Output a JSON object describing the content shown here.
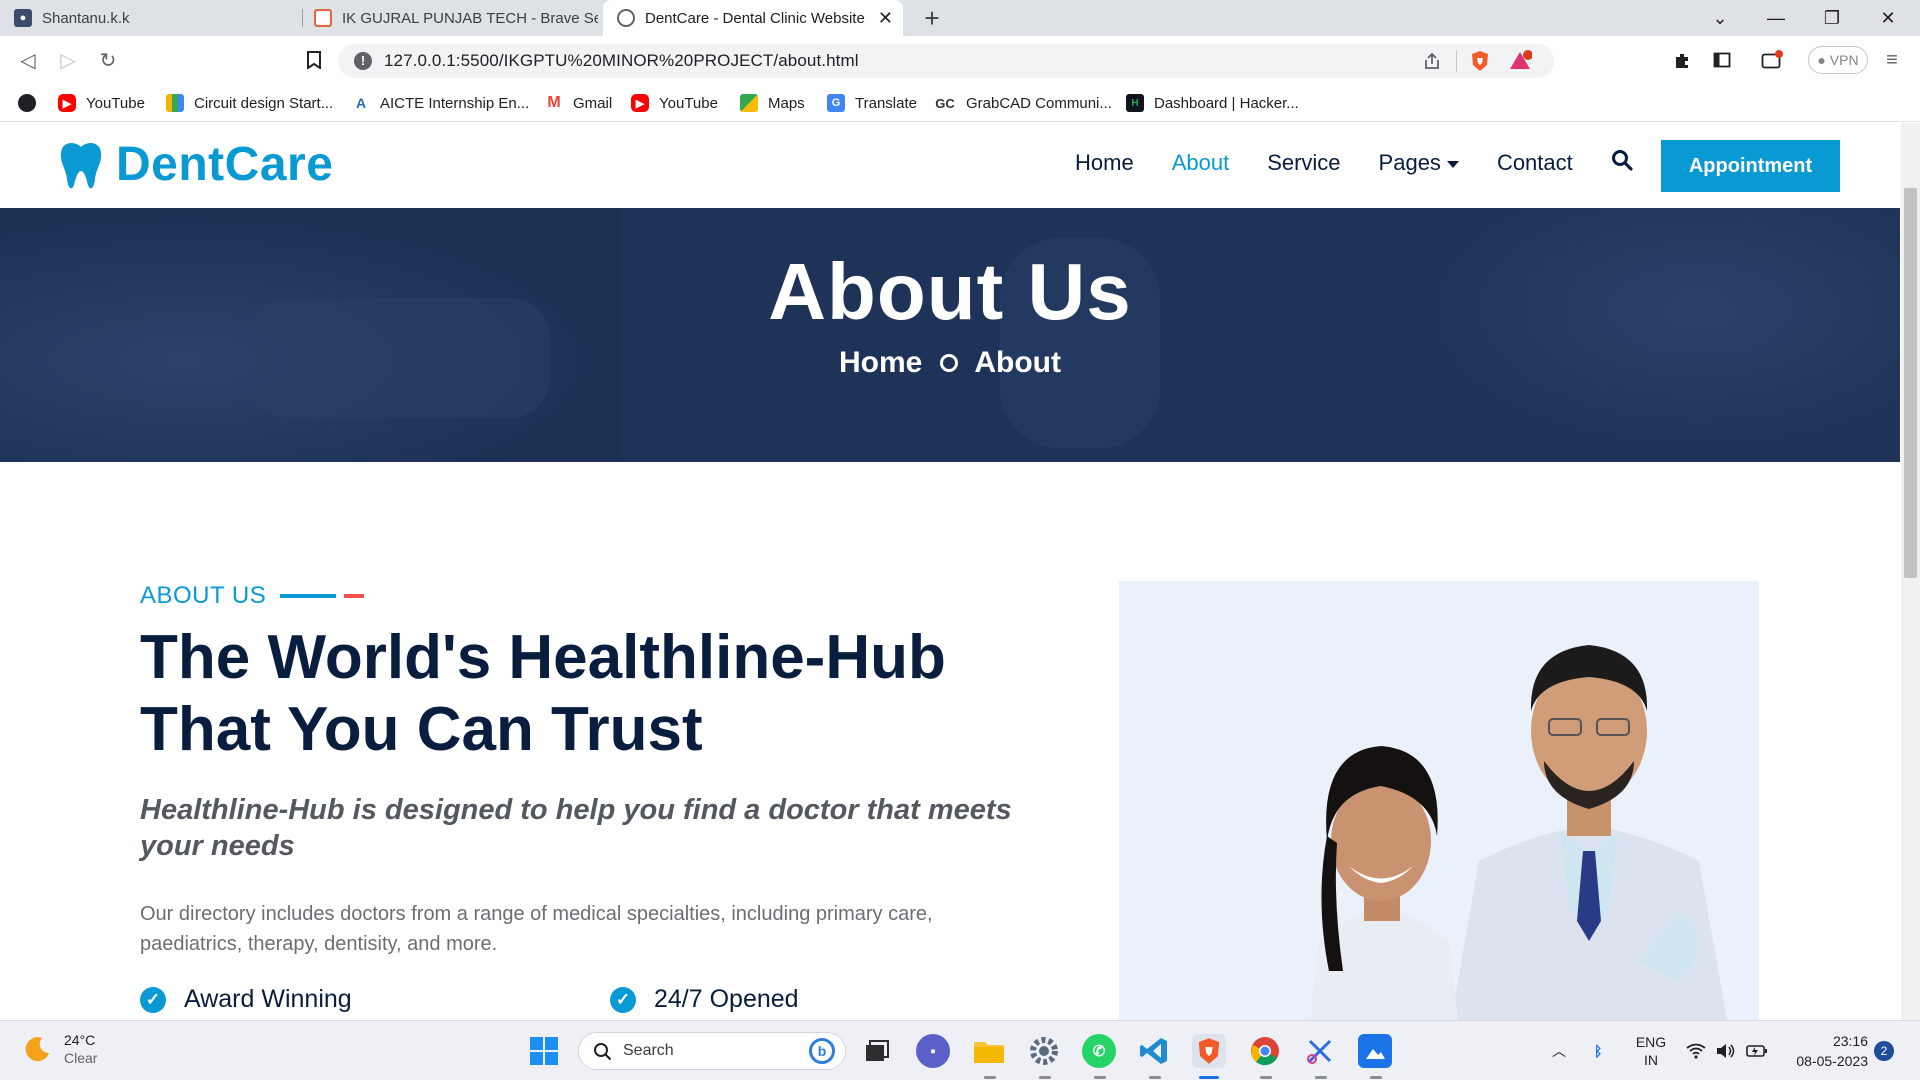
{
  "browser": {
    "tabs": [
      {
        "title": "Shantanu.k.k",
        "active": false
      },
      {
        "title": "IK GUJRAL PUNJAB TECH - Brave Search",
        "active": false
      },
      {
        "title": "DentCare - Dental Clinic Website",
        "active": true
      }
    ],
    "new_tab_icon": "plus-icon",
    "url": "127.0.0.1:5500/IKGPTU%20MINOR%20PROJECT/about.html",
    "vpn_label": "VPN"
  },
  "bookmarks": [
    {
      "label": "YouTube",
      "icon": "youtube-icon",
      "color": "#ff0000"
    },
    {
      "label": "Circuit design Start...",
      "icon": "grid-icon",
      "color": "#f4b400"
    },
    {
      "label": "AICTE Internship En...",
      "icon": "aicte-icon",
      "color": "#2b6cb0"
    },
    {
      "label": "Gmail",
      "icon": "gmail-icon",
      "color": "#ea4335"
    },
    {
      "label": "YouTube",
      "icon": "youtube-icon",
      "color": "#ff0000"
    },
    {
      "label": "Maps",
      "icon": "maps-icon",
      "color": "#34a853"
    },
    {
      "label": "Translate",
      "icon": "translate-icon",
      "color": "#4285f4"
    },
    {
      "label": "GrabCAD Communi...",
      "icon": "grabcad-icon",
      "color": "#333333"
    },
    {
      "label": "Dashboard | Hacker...",
      "icon": "hackerrank-icon",
      "color": "#1ba94c"
    }
  ],
  "site": {
    "logo": "DentCare",
    "nav": {
      "home": "Home",
      "about": "About",
      "service": "Service",
      "pages": "Pages",
      "contact": "Contact",
      "appointment": "Appointment"
    },
    "hero": {
      "title": "About Us",
      "crumb_home": "Home",
      "crumb_current": "About"
    },
    "about": {
      "eyebrow": "ABOUT US",
      "heading": "The World's Healthline-Hub That You Can Trust",
      "tagline": "Healthline-Hub is designed to help you find a doctor that meets your needs",
      "description": "Our directory includes doctors from a range of medical specialties, including primary care, paediatrics, therapy, dentisity, and more.",
      "features": [
        "Award Winning",
        "24/7 Opened"
      ]
    },
    "colors": {
      "primary": "#0a9ad3",
      "dark": "#091e3e"
    }
  },
  "taskbar": {
    "weather_temp": "24°C",
    "weather_desc": "Clear",
    "search_placeholder": "Search",
    "lang_top": "ENG",
    "lang_bottom": "IN",
    "time": "23:16",
    "date": "08-05-2023",
    "notifications": "2"
  }
}
